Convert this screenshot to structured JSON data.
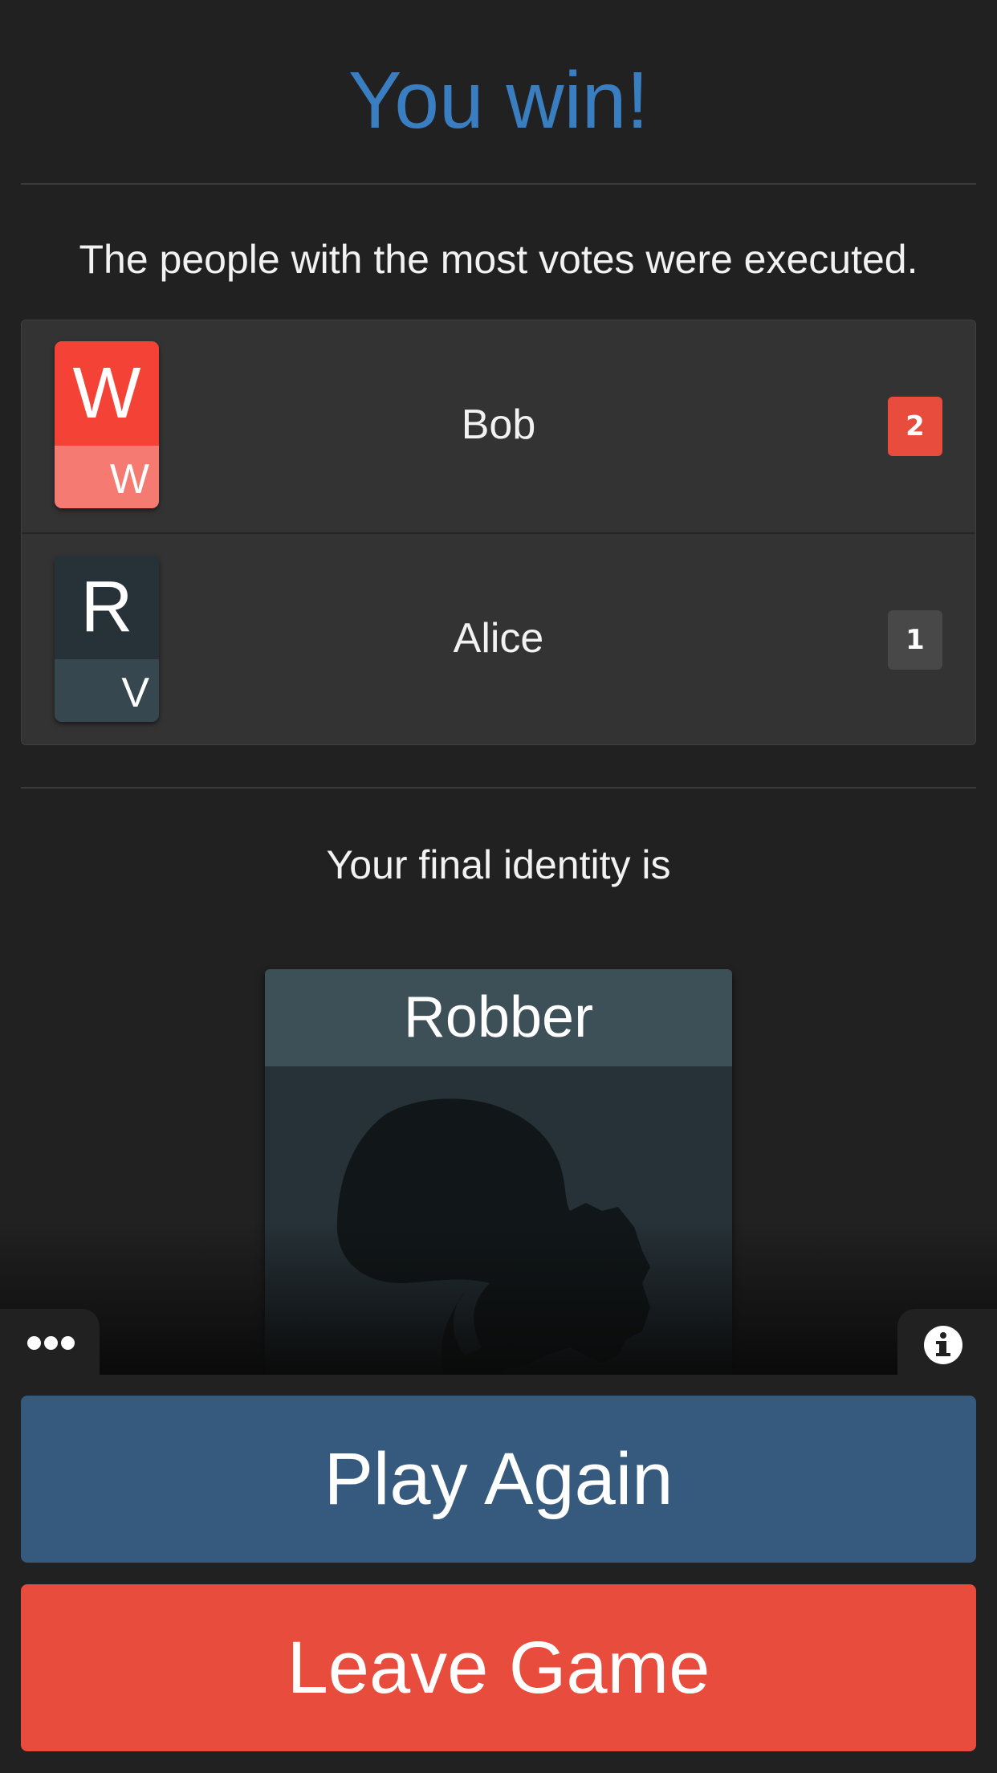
{
  "title": "You win!",
  "result_text": "The people with the most votes were executed.",
  "votes": [
    {
      "card_main": "W",
      "card_sub": "W",
      "name": "Bob",
      "count": "2"
    },
    {
      "card_main": "R",
      "card_sub": "V",
      "name": "Alice",
      "count": "1"
    }
  ],
  "identity_label": "Your final identity is",
  "identity_role": "Robber",
  "buttons": {
    "play_again": "Play Again",
    "leave_game": "Leave Game"
  },
  "icons": {
    "menu": "more-horizontal-icon",
    "info": "info-icon"
  },
  "colors": {
    "title": "#3a7ec2",
    "werewolf": "#f44336",
    "play_again": "#365a7d",
    "leave_game": "#e74c3c"
  }
}
